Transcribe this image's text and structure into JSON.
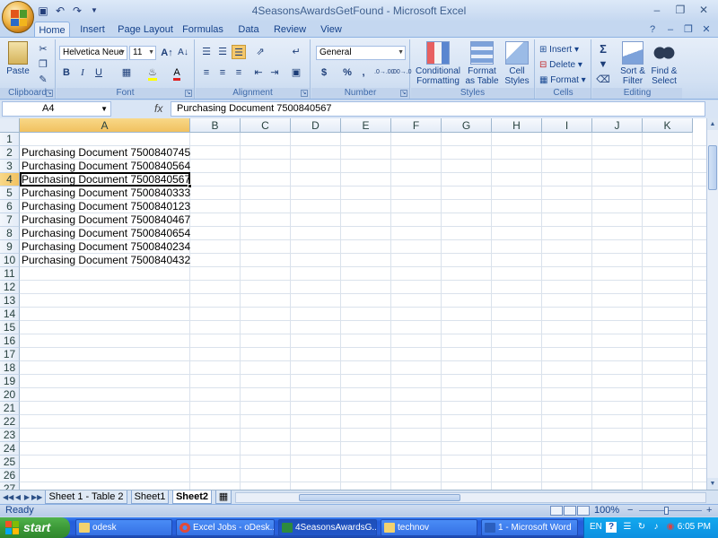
{
  "window": {
    "title": "4SeasonsAwardsGetFound - Microsoft Excel"
  },
  "qat": {
    "save_icon": "save-icon",
    "undo_icon": "undo-icon",
    "redo_icon": "redo-icon",
    "customize_icon": "chevron-down-icon"
  },
  "tabs": [
    "Home",
    "Insert",
    "Page Layout",
    "Formulas",
    "Data",
    "Review",
    "View"
  ],
  "active_tab": "Home",
  "ribbon": {
    "clipboard": {
      "label": "Clipboard",
      "paste": "Paste"
    },
    "font": {
      "label": "Font",
      "name": "Helvetica Neue",
      "size": "11",
      "bold": "B",
      "italic": "I",
      "underline": "U"
    },
    "alignment": {
      "label": "Alignment"
    },
    "number": {
      "label": "Number",
      "format": "General",
      "currency": "$",
      "percent": "%",
      "comma": ",",
      "inc_decimal": ".0→.00",
      "dec_decimal": ".00→.0"
    },
    "styles": {
      "label": "Styles",
      "conditional": "Conditional",
      "conditional2": "Formatting",
      "format_table": "Format",
      "format_table2": "as Table",
      "cell_styles": "Cell",
      "cell_styles2": "Styles"
    },
    "cells": {
      "label": "Cells",
      "insert": "Insert",
      "delete": "Delete",
      "format": "Format"
    },
    "editing": {
      "label": "Editing",
      "sigma": "Σ",
      "sort": "Sort &",
      "sort2": "Filter",
      "find": "Find &",
      "find2": "Select"
    }
  },
  "formula_bar": {
    "name_box": "A4",
    "fx": "fx",
    "content": "Purchasing Document 7500840567"
  },
  "columns": [
    "A",
    "B",
    "C",
    "D",
    "E",
    "F",
    "G",
    "H",
    "I",
    "J",
    "K"
  ],
  "rows": [
    "1",
    "2",
    "3",
    "4",
    "5",
    "6",
    "7",
    "8",
    "9",
    "10",
    "11",
    "12",
    "13",
    "14",
    "15",
    "16",
    "17",
    "18",
    "19",
    "20",
    "21",
    "22",
    "23",
    "24",
    "25",
    "26",
    "27"
  ],
  "cells": [
    "",
    "Purchasing Document 7500840745",
    "Purchasing Document 7500840564",
    "Purchasing Document 7500840567",
    "Purchasing Document 7500840333",
    "Purchasing Document 7500840123",
    "Purchasing Document 7500840467",
    "Purchasing Document 7500840654",
    "Purchasing Document 7500840234",
    "Purchasing Document 7500840432"
  ],
  "selected_row": "4",
  "selected_col": "A",
  "sheets": [
    "Sheet 1 - Table 2",
    "Sheet1",
    "Sheet2"
  ],
  "active_sheet": "Sheet2",
  "status": {
    "text": "Ready",
    "zoom": "100%",
    "minus": "−",
    "plus": "+"
  },
  "taskbar": {
    "start": "start",
    "tasks": [
      "odesk",
      "Excel Jobs - oDesk...",
      "4SeasonsAwardsG...",
      "technov",
      "1 - Microsoft Word"
    ],
    "lang": "EN",
    "clock": "6:05 PM"
  },
  "colors": {
    "accent": "#15428b",
    "ribbon": "#dbe7f6",
    "selection": "#f1c15f",
    "taskbar": "#245edb",
    "start": "#3c9a38"
  }
}
